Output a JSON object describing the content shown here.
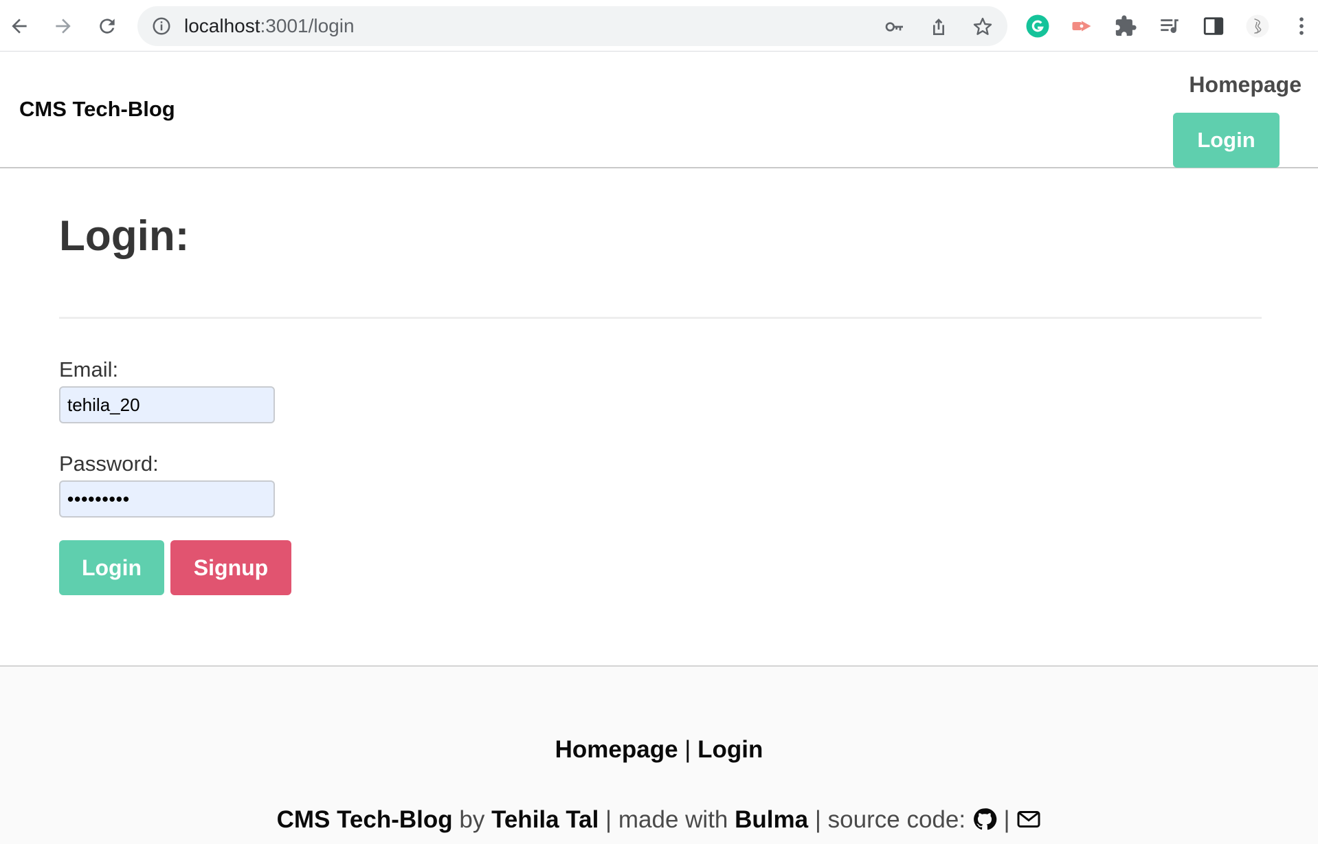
{
  "browser": {
    "url_host": "localhost",
    "url_path": ":3001/login",
    "icons": [
      "back-arrow-icon",
      "forward-arrow-icon",
      "reload-icon",
      "info-icon",
      "key-icon",
      "share-icon",
      "star-icon",
      "grammarly-icon",
      "extension-red-icon",
      "puzzle-icon",
      "media-icon",
      "sidepanel-icon",
      "profile-avatar-icon",
      "kebab-menu-icon"
    ]
  },
  "navbar": {
    "brand": "CMS Tech-Blog",
    "homepage": "Homepage",
    "login": "Login"
  },
  "main": {
    "title": "Login:",
    "email_label": "Email:",
    "email_value": "tehila_20",
    "password_label": "Password:",
    "password_value": "•••••••••",
    "login_button": "Login",
    "signup_button": "Signup"
  },
  "footer": {
    "link_homepage": "Homepage",
    "separator": "|",
    "link_login": "Login",
    "credits_brand": "CMS Tech-Blog",
    "credits_by": "by",
    "credits_author": "Tehila Tal",
    "credits_made_with": "made with",
    "credits_framework": "Bulma",
    "credits_source": "source code:"
  },
  "colors": {
    "primary": "#5fcfae",
    "danger": "#e15470",
    "autofill": "#e8f0fe"
  }
}
